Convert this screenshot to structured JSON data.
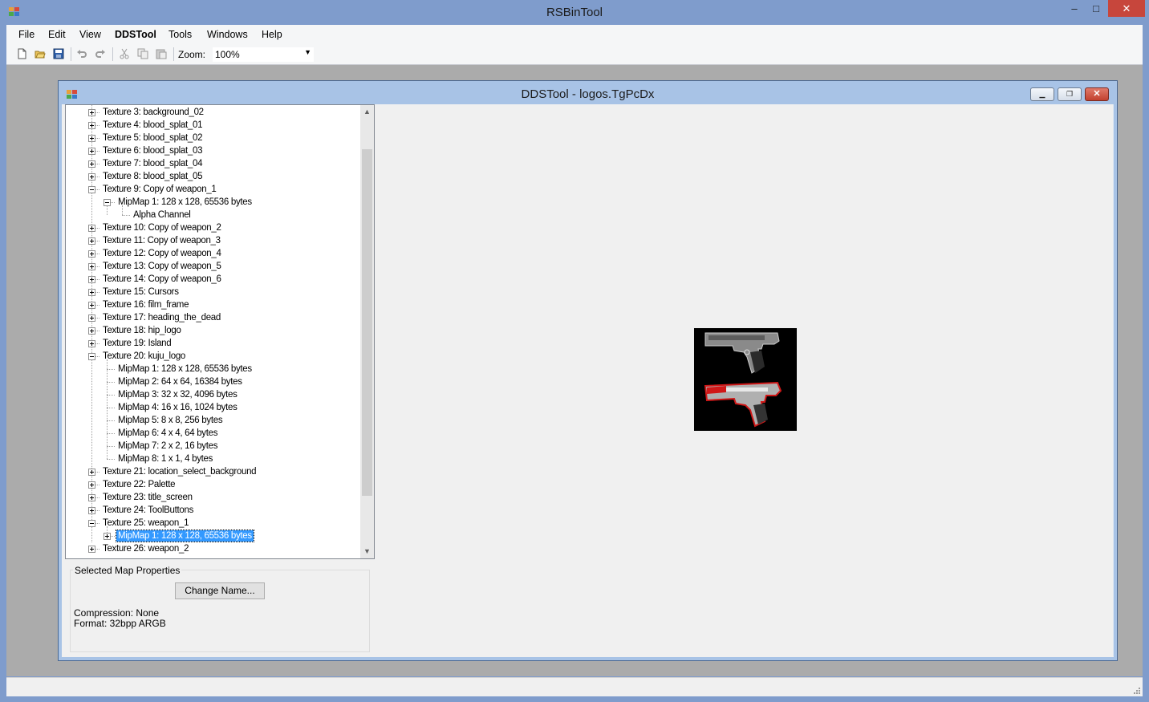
{
  "app": {
    "title": "RSBinTool",
    "window_controls": {
      "minimize": "‒",
      "maximize": "□",
      "close": "✕"
    }
  },
  "menu": [
    "File",
    "Edit",
    "View",
    "DDSTool",
    "Tools",
    "Windows",
    "Help"
  ],
  "toolbar": {
    "zoom_label": "Zoom:",
    "zoom_value": "100%",
    "icons": [
      "new-file-icon",
      "open-folder-icon",
      "save-icon",
      "undo-icon",
      "redo-icon",
      "cut-icon",
      "copy-icon",
      "paste-icon"
    ]
  },
  "child_window": {
    "title": "DDSTool - logos.TgPcDx"
  },
  "tree": {
    "rows": [
      {
        "text": "Texture 3: background_02",
        "level": 0,
        "expander": "plus"
      },
      {
        "text": "Texture 4: blood_splat_01",
        "level": 0,
        "expander": "plus"
      },
      {
        "text": "Texture 5: blood_splat_02",
        "level": 0,
        "expander": "plus"
      },
      {
        "text": "Texture 6: blood_splat_03",
        "level": 0,
        "expander": "plus"
      },
      {
        "text": "Texture 7: blood_splat_04",
        "level": 0,
        "expander": "plus"
      },
      {
        "text": "Texture 8: blood_splat_05",
        "level": 0,
        "expander": "plus"
      },
      {
        "text": "Texture 9: Copy of weapon_1",
        "level": 0,
        "expander": "minus"
      },
      {
        "text": "MipMap 1: 128 x 128, 65536 bytes",
        "level": 1,
        "expander": "minus"
      },
      {
        "text": "Alpha Channel",
        "level": 2,
        "expander": "none"
      },
      {
        "text": "Texture 10: Copy of weapon_2",
        "level": 0,
        "expander": "plus"
      },
      {
        "text": "Texture 11: Copy of weapon_3",
        "level": 0,
        "expander": "plus"
      },
      {
        "text": "Texture 12: Copy of weapon_4",
        "level": 0,
        "expander": "plus"
      },
      {
        "text": "Texture 13: Copy of weapon_5",
        "level": 0,
        "expander": "plus"
      },
      {
        "text": "Texture 14: Copy of weapon_6",
        "level": 0,
        "expander": "plus"
      },
      {
        "text": "Texture 15: Cursors",
        "level": 0,
        "expander": "plus"
      },
      {
        "text": "Texture 16: film_frame",
        "level": 0,
        "expander": "plus"
      },
      {
        "text": "Texture 17: heading_the_dead",
        "level": 0,
        "expander": "plus"
      },
      {
        "text": "Texture 18: hip_logo",
        "level": 0,
        "expander": "plus"
      },
      {
        "text": "Texture 19: Island",
        "level": 0,
        "expander": "plus"
      },
      {
        "text": "Texture 20: kuju_logo",
        "level": 0,
        "expander": "minus"
      },
      {
        "text": "MipMap 1: 128 x 128, 65536 bytes",
        "level": 1,
        "expander": "none"
      },
      {
        "text": "MipMap 2: 64 x 64, 16384 bytes",
        "level": 1,
        "expander": "none"
      },
      {
        "text": "MipMap 3: 32 x 32, 4096 bytes",
        "level": 1,
        "expander": "none"
      },
      {
        "text": "MipMap 4: 16 x 16, 1024 bytes",
        "level": 1,
        "expander": "none"
      },
      {
        "text": "MipMap 5: 8 x 8, 256 bytes",
        "level": 1,
        "expander": "none"
      },
      {
        "text": "MipMap 6: 4 x 4, 64 bytes",
        "level": 1,
        "expander": "none"
      },
      {
        "text": "MipMap 7: 2 x 2, 16 bytes",
        "level": 1,
        "expander": "none"
      },
      {
        "text": "MipMap 8: 1 x 1, 4 bytes",
        "level": 1,
        "expander": "none"
      },
      {
        "text": "Texture 21: location_select_background",
        "level": 0,
        "expander": "plus"
      },
      {
        "text": "Texture 22: Palette",
        "level": 0,
        "expander": "plus"
      },
      {
        "text": "Texture 23: title_screen",
        "level": 0,
        "expander": "plus"
      },
      {
        "text": "Texture 24: ToolButtons",
        "level": 0,
        "expander": "plus"
      },
      {
        "text": "Texture 25: weapon_1",
        "level": 0,
        "expander": "minus"
      },
      {
        "text": "MipMap 1: 128 x 128, 65536 bytes",
        "level": 1,
        "expander": "plus",
        "selected": true
      },
      {
        "text": "Texture 26: weapon_2",
        "level": 0,
        "expander": "plus"
      }
    ]
  },
  "properties": {
    "group_title": "Selected Map Properties",
    "change_name_button": "Change Name...",
    "compression": "Compression: None",
    "format": "Format: 32bpp ARGB"
  }
}
